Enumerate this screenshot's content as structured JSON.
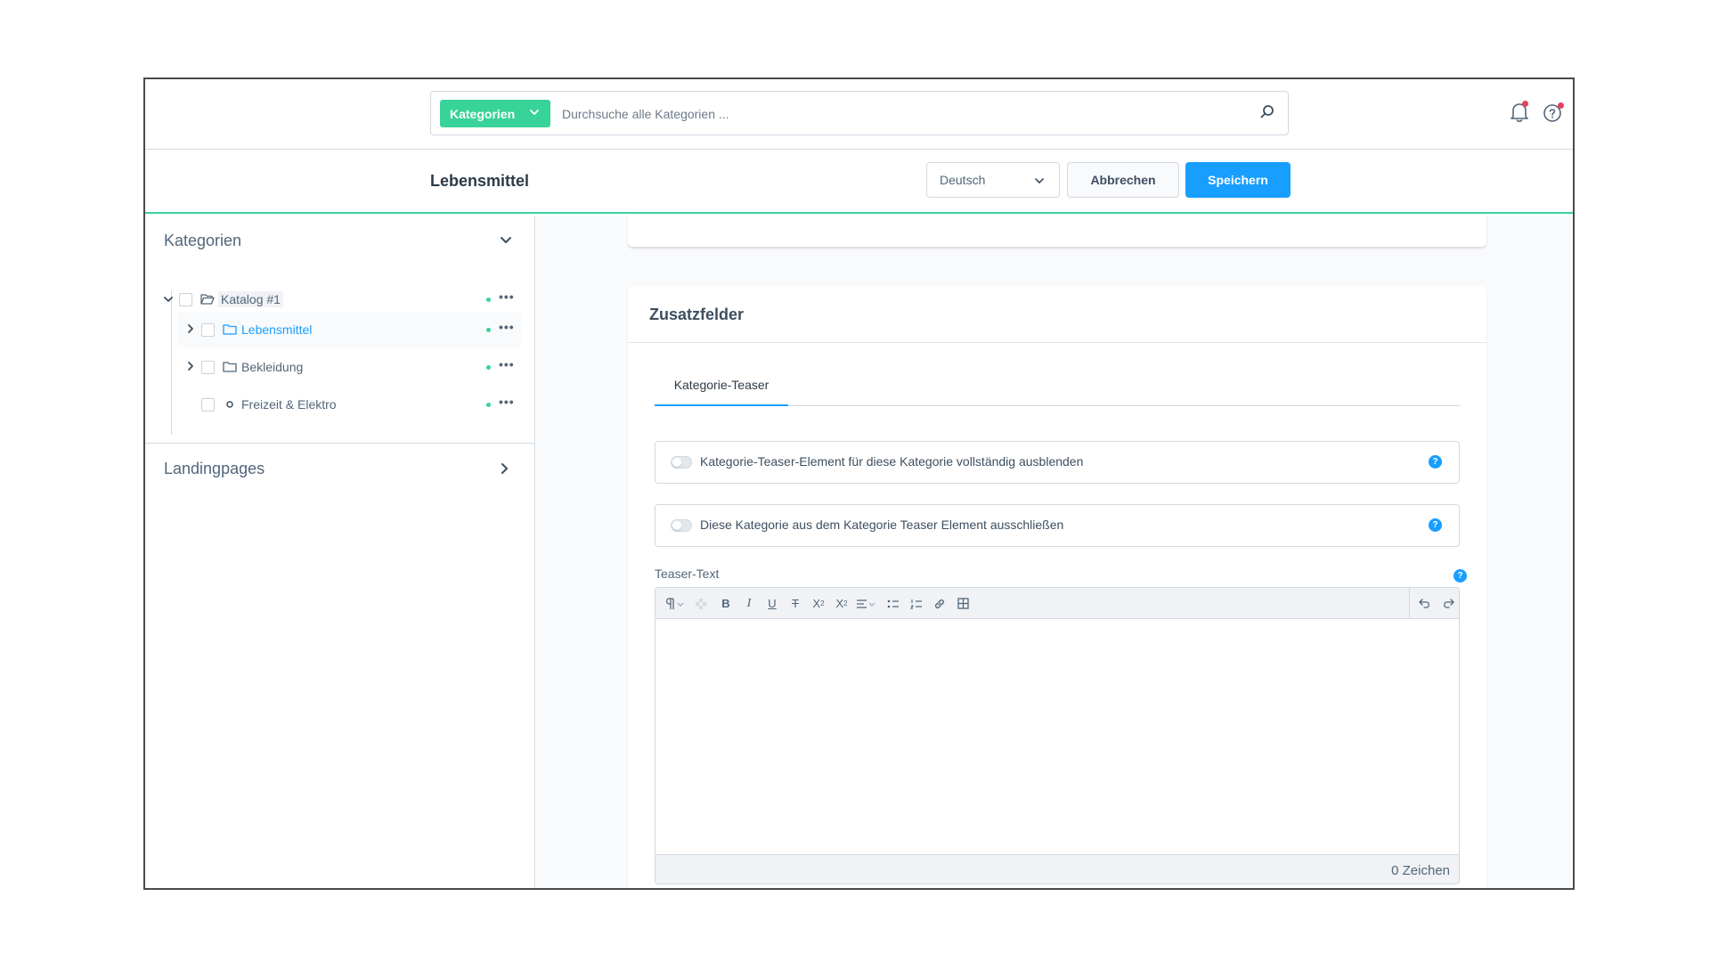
{
  "search": {
    "type_label": "Kategorien",
    "placeholder": "Durchsuche alle Kategorien ..."
  },
  "smartbar": {
    "title": "Lebensmittel",
    "language": "Deutsch",
    "cancel_label": "Abbrechen",
    "save_label": "Speichern"
  },
  "sidebar": {
    "categories_heading": "Kategorien",
    "tree": [
      {
        "label": "Katalog #1",
        "icon": "folder-open-icon",
        "expanded": true,
        "active": false
      },
      {
        "label": "Lebensmittel",
        "icon": "folder-icon",
        "expanded": false,
        "active": true
      },
      {
        "label": "Bekleidung",
        "icon": "folder-icon",
        "expanded": false,
        "active": false
      },
      {
        "label": "Freizeit & Elektro",
        "icon": "leaf-dot-icon",
        "expanded": false,
        "active": false
      }
    ],
    "landingpages_heading": "Landingpages"
  },
  "card": {
    "title": "Zusatzfelder",
    "tab_label": "Kategorie-Teaser",
    "switch1_label": "Kategorie-Teaser-Element für diese Kategorie vollständig ausblenden",
    "switch2_label": "Diese Kategorie aus dem Kategorie Teaser Element ausschließen",
    "teaser_text_label": "Teaser-Text",
    "char_count": "0 Zeichen",
    "help_glyph": "?"
  },
  "colors": {
    "accent_green": "#37d398",
    "primary_blue": "#189eff",
    "notification_red": "#e3435b"
  }
}
